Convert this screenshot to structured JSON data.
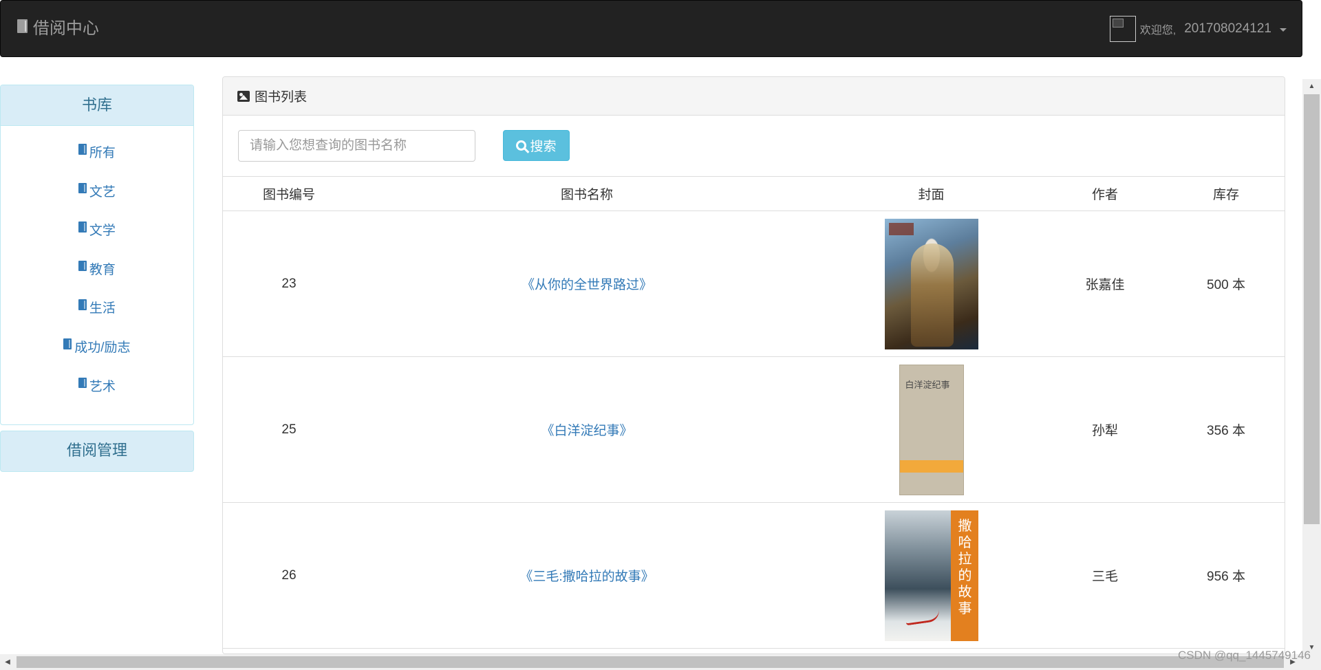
{
  "navbar": {
    "brand": "借阅中心",
    "welcome": "欢迎您,",
    "user_id": "201708024121"
  },
  "sidebar": {
    "library_title": "书库",
    "categories": [
      {
        "label": "所有"
      },
      {
        "label": "文艺"
      },
      {
        "label": "文学"
      },
      {
        "label": "教育"
      },
      {
        "label": "生活"
      },
      {
        "label": "成功/励志"
      },
      {
        "label": "艺术"
      }
    ],
    "borrow_title": "借阅管理"
  },
  "main": {
    "panel_title": "图书列表",
    "search": {
      "placeholder": "请输入您想查询的图书名称",
      "value": "",
      "button_label": "搜索"
    },
    "columns": [
      "图书编号",
      "图书名称",
      "封面",
      "作者",
      "库存"
    ],
    "rows": [
      {
        "id": "23",
        "title": "《从你的全世界路过》",
        "author": "张嘉佳",
        "stock": "500 本"
      },
      {
        "id": "25",
        "title": "《白洋淀纪事》",
        "author": "孙犁",
        "stock": "356 本"
      },
      {
        "id": "26",
        "title": "《三毛:撒哈拉的故事》",
        "author": "三毛",
        "stock": "956 本"
      }
    ],
    "cover_texts": {
      "cover_2_title": "白洋淀纪事",
      "cover_3_title": "撒哈拉的故事"
    }
  },
  "watermark": "CSDN @qq_1445749146",
  "colors": {
    "navbar_bg": "#222222",
    "link": "#337ab7",
    "info_button": "#5bc0de",
    "panel_info_bg": "#d9edf7"
  }
}
